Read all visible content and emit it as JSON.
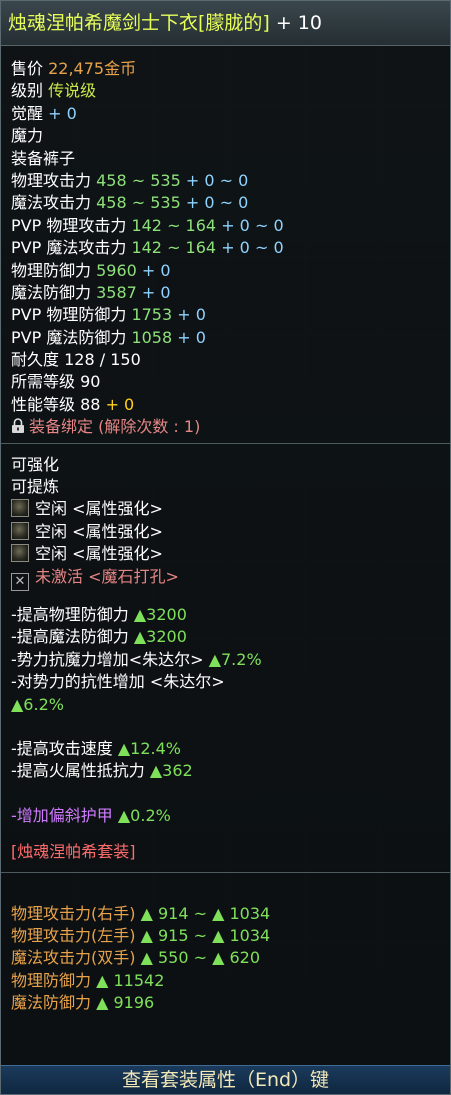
{
  "title": {
    "name": "烛魂涅帕希魔剑士下衣[朦胧的]",
    "enhance": "+ 10"
  },
  "base": {
    "price_label": "售价",
    "price_value": "22,475金币",
    "grade_label": "级别",
    "grade_value": "传说级",
    "awaken_label": "觉醒",
    "awaken_value": "+ 0",
    "magic_label": "魔力",
    "equip_label": "装备",
    "equip_value": "裤子",
    "phys_atk_label": "物理攻击力",
    "phys_atk_value": "458 ~ 535",
    "phys_atk_bonus": "+ 0 ~ 0",
    "mag_atk_label": "魔法攻击力",
    "mag_atk_value": "458 ~ 535",
    "mag_atk_bonus": "+ 0 ~ 0",
    "pvp_phys_atk_label": "PVP 物理攻击力",
    "pvp_phys_atk_value": "142 ~ 164",
    "pvp_phys_atk_bonus": "+ 0 ~ 0",
    "pvp_mag_atk_label": "PVP 魔法攻击力",
    "pvp_mag_atk_value": "142 ~ 164",
    "pvp_mag_atk_bonus": "+ 0 ~ 0",
    "phys_def_label": "物理防御力",
    "phys_def_value": "5960",
    "phys_def_bonus": "+ 0",
    "mag_def_label": "魔法防御力",
    "mag_def_value": "3587",
    "mag_def_bonus": "+ 0",
    "pvp_phys_def_label": "PVP 物理防御力",
    "pvp_phys_def_value": "1753",
    "pvp_phys_def_bonus": "+ 0",
    "pvp_mag_def_label": "PVP 魔法防御力",
    "pvp_mag_def_value": "1058",
    "pvp_mag_def_bonus": "+ 0",
    "durability_label": "耐久度",
    "durability_value": "128 / 150",
    "req_level_label": "所需等级",
    "req_level_value": "90",
    "perf_level_label": "性能等级",
    "perf_level_value": "88",
    "perf_level_bonus": "+ 0",
    "bind_text": "装备绑定 (解除次数 : 1)"
  },
  "enhance": {
    "can_enhance": "可强化",
    "can_refine": "可提炼",
    "slots": [
      {
        "status": "空闲",
        "type": "<属性强化>"
      },
      {
        "status": "空闲",
        "type": "<属性强化>"
      },
      {
        "status": "空闲",
        "type": "<属性强化>"
      }
    ],
    "inactive_status": "未激活",
    "inactive_type": "<魔石打孔>"
  },
  "options": {
    "opt1_label": "-提高物理防御力",
    "opt1_value": "▲3200",
    "opt2_label": "-提高魔法防御力",
    "opt2_value": "▲3200",
    "opt3_label": "-势力抗魔力增加<朱达尔>",
    "opt3_value": "▲7.2%",
    "opt4_label": "-对势力的抗性增加 <朱达尔>",
    "opt4_value": "▲6.2%",
    "opt5_label": "-提高攻击速度",
    "opt5_value": "▲12.4%",
    "opt6_label": "-提高火属性抵抗力",
    "opt6_value": "▲362",
    "opt7_label": "-增加偏斜护甲",
    "opt7_value": "▲0.2%"
  },
  "set": {
    "name": "[烛魂涅帕希套装]",
    "b1_label": "物理攻击力(右手)",
    "b1_value": "▲ 914 ~ ▲ 1034",
    "b2_label": "物理攻击力(左手)",
    "b2_value": "▲ 915 ~ ▲ 1034",
    "b3_label": "魔法攻击力(双手)",
    "b3_value": "▲ 550 ~ ▲ 620",
    "b4_label": "物理防御力",
    "b4_value": "▲ 11542",
    "b5_label": "魔法防御力",
    "b5_value": "▲ 9196"
  },
  "footer": {
    "label": "查看套装属性（End）键"
  }
}
